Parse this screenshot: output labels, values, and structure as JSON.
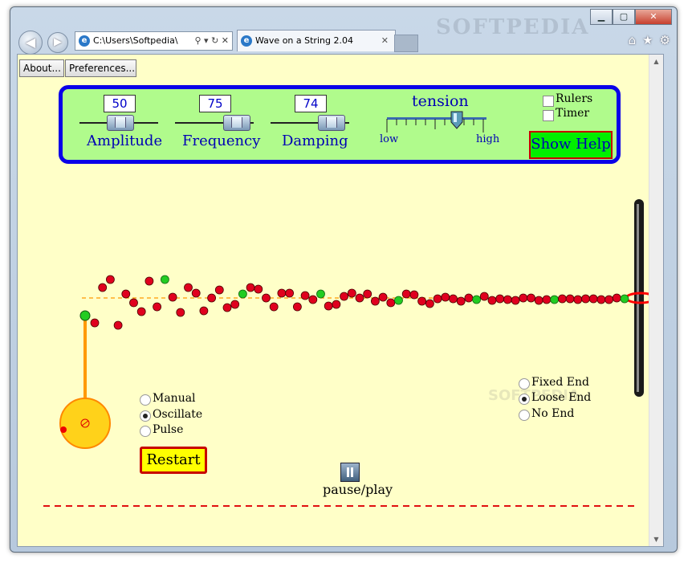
{
  "window": {
    "watermark": "SOFTPEDIA",
    "minimize": "▁",
    "maximize": "▢",
    "close": "✕"
  },
  "browser": {
    "address": "C:\\Users\\Softpedia\\",
    "tab_title": "Wave on a String 2.04",
    "back_icon": "back-arrow-icon",
    "forward_icon": "forward-arrow-icon"
  },
  "toolbar": {
    "about_label": "About...",
    "preferences_label": "Preferences..."
  },
  "controls": {
    "amplitude": {
      "label": "Amplitude",
      "value": "50",
      "fraction": 0.5
    },
    "frequency": {
      "label": "Frequency",
      "value": "75",
      "fraction": 0.75
    },
    "damping": {
      "label": "Damping",
      "value": "74",
      "fraction": 0.74
    },
    "tension": {
      "label": "tension",
      "low": "low",
      "high": "high",
      "fraction": 0.7
    },
    "rulers_label": "Rulers",
    "timer_label": "Timer",
    "show_help_label": "Show Help"
  },
  "modes": {
    "manual": "Manual",
    "oscillate": "Oscillate",
    "pulse": "Pulse",
    "selected": "oscillate"
  },
  "restart_label": "Restart",
  "pause_play_label": "pause/play",
  "ends": {
    "fixed": "Fixed End",
    "loose": "Loose End",
    "none": "No End",
    "selected": "loose"
  },
  "softpedia_mark": "SOFTPEDIA",
  "colors": {
    "bead": "#e0001e",
    "bead_green": "#22cc22",
    "panel_bg": "#b0fb8c",
    "panel_border": "#0a00e8",
    "sim_bg": "#ffffc8"
  }
}
